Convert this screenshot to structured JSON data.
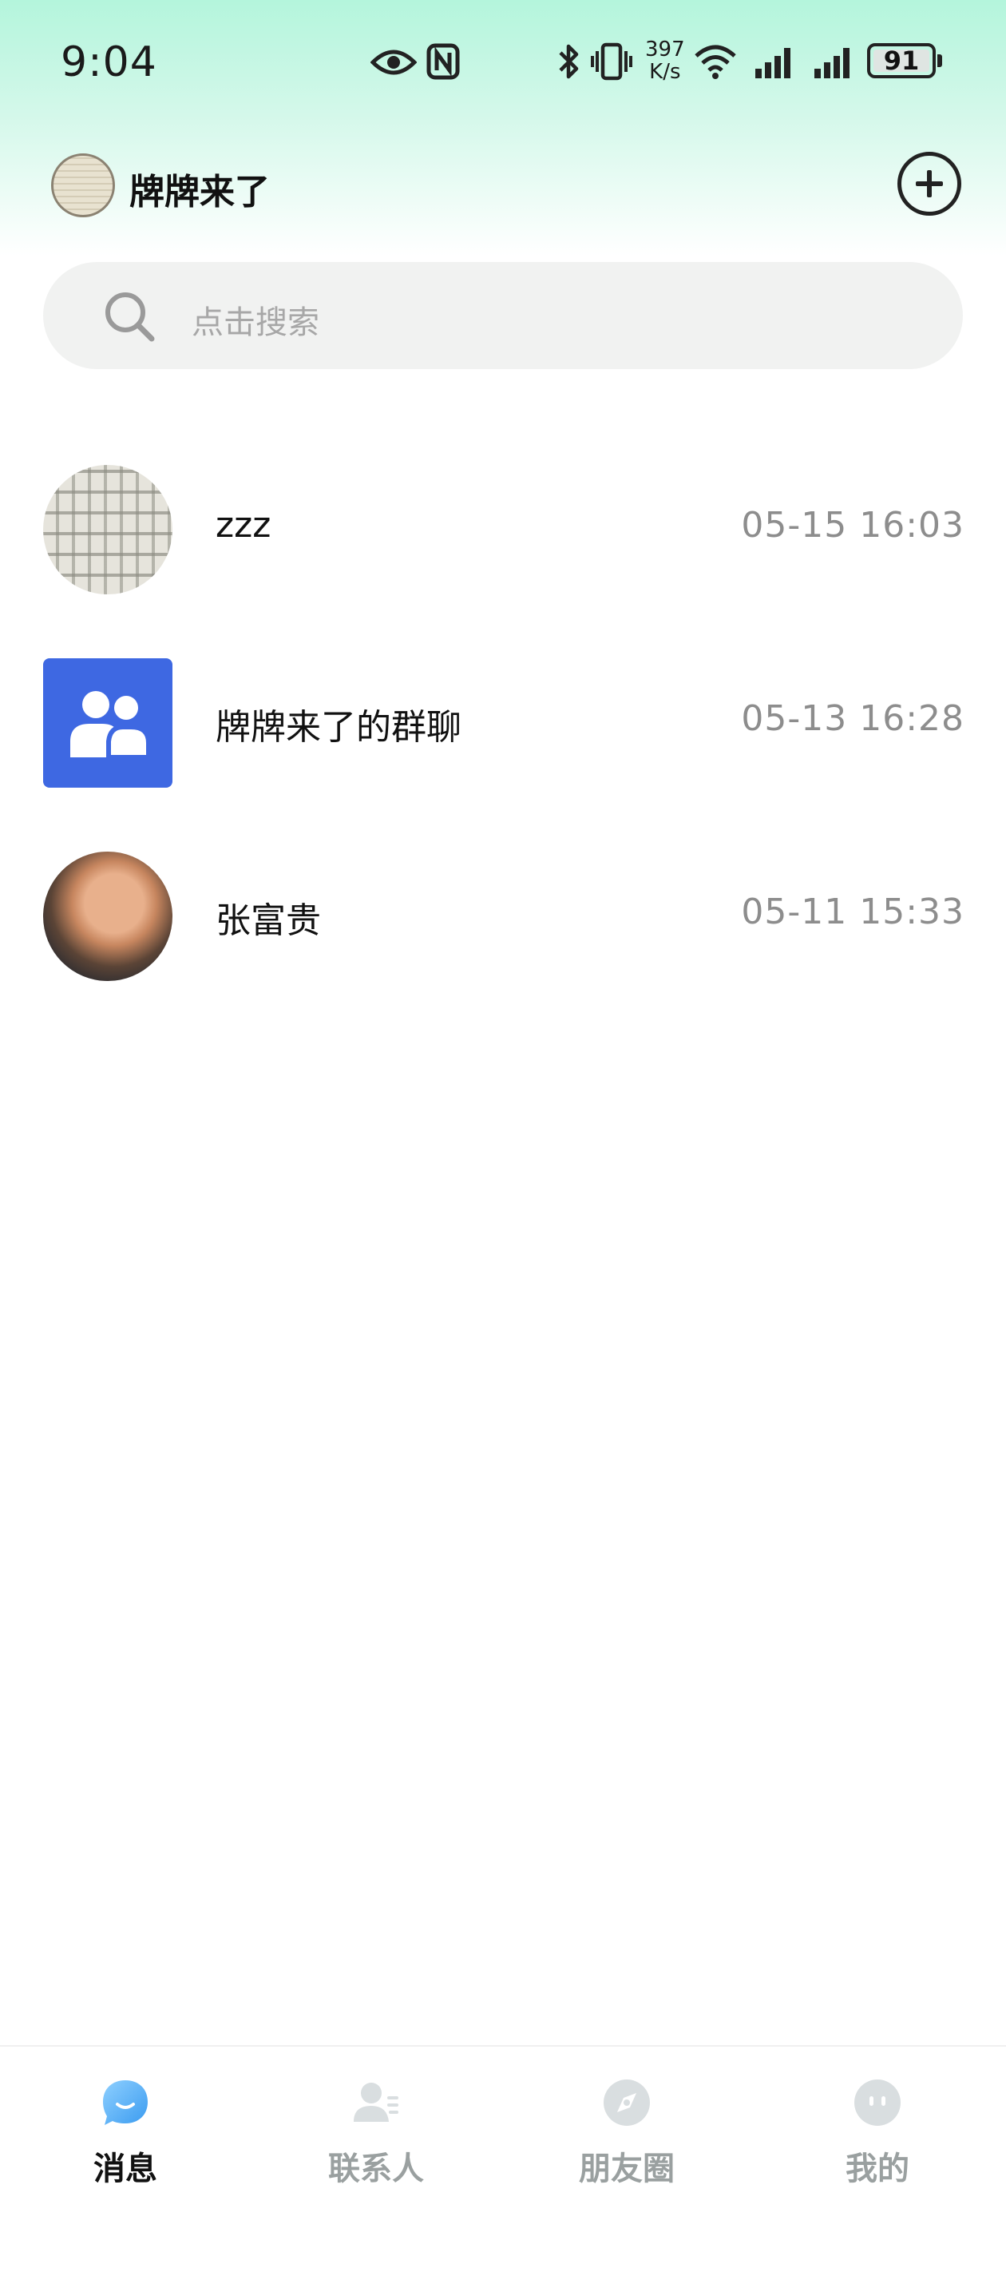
{
  "status_bar": {
    "time": "9:04",
    "speed_value": "397",
    "speed_unit": "K/s",
    "battery": "91",
    "battery_level": 0.91,
    "icons": [
      "eye-icon",
      "nfc-icon",
      "bluetooth-icon",
      "vibrate-icon",
      "wifi-icon",
      "signal-icon",
      "signal-icon",
      "battery-icon"
    ]
  },
  "header": {
    "title": "牌牌来了",
    "add_icon": "plus-circle-icon"
  },
  "search": {
    "placeholder": "点击搜索",
    "icon": "search-icon"
  },
  "conversations": [
    {
      "name": "zzz",
      "time": "05-15 16:03",
      "avatar": "keyboard-photo"
    },
    {
      "name": "牌牌来了的群聊",
      "time": "05-13 16:28",
      "avatar": "group-icon"
    },
    {
      "name": "张富贵",
      "time": "05-11 15:33",
      "avatar": "person-photo"
    }
  ],
  "nav": [
    {
      "label": "消息",
      "icon": "chat-bubble-icon",
      "active": true
    },
    {
      "label": "联系人",
      "icon": "contacts-icon",
      "active": false
    },
    {
      "label": "朋友圈",
      "icon": "compass-icon",
      "active": false
    },
    {
      "label": "我的",
      "icon": "profile-face-icon",
      "active": false
    }
  ],
  "colors": {
    "accent": "#4aa8f5",
    "group_avatar": "#3e68e2",
    "inactive": "#9aa0a0",
    "header_gradient": "#b4f5dc"
  }
}
